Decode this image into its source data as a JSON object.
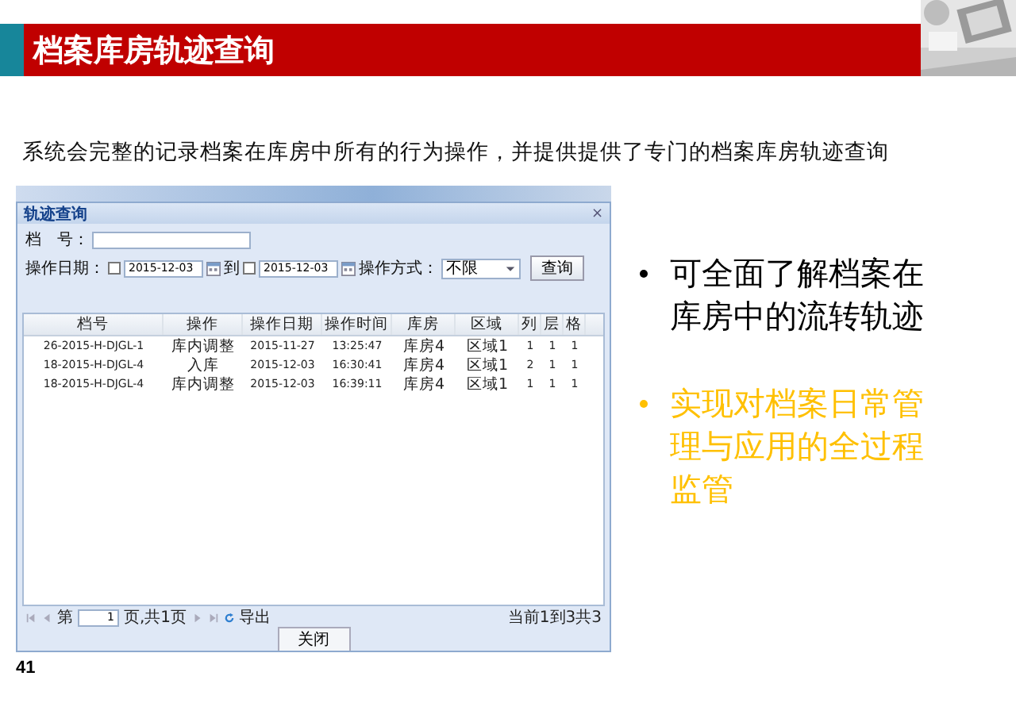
{
  "slide_title": "档案库房轨迹查询",
  "description": "系统会完整的记录档案在库房中所有的行为操作，并提供提供了专门的档案库房轨迹查询",
  "window": {
    "title": "轨迹查询",
    "close": "×",
    "filters": {
      "file_no_label": "档　号：",
      "date_label": "操作日期：",
      "date_from": {
        "checked": false,
        "value": "2015-12-03"
      },
      "to_label": "到",
      "date_to": {
        "checked": false,
        "value": "2015-12-03"
      },
      "mode_label": "操作方式：",
      "mode_value": "不限",
      "search_button": "查询"
    },
    "table": {
      "columns": [
        "档号",
        "操作",
        "操作日期",
        "操作时间",
        "库房",
        "区域",
        "列",
        "层",
        "格"
      ],
      "rows": [
        [
          "26-2015-H-DJGL-1",
          "库内调整",
          "2015-11-27",
          "13:25:47",
          "库房4",
          "区域1",
          "1",
          "1",
          "1"
        ],
        [
          "18-2015-H-DJGL-4",
          "入库",
          "2015-12-03",
          "16:30:41",
          "库房4",
          "区域1",
          "2",
          "1",
          "1"
        ],
        [
          "18-2015-H-DJGL-4",
          "库内调整",
          "2015-12-03",
          "16:39:11",
          "库房4",
          "区域1",
          "1",
          "1",
          "1"
        ]
      ]
    },
    "pager": {
      "page_prefix": "第",
      "page": "1",
      "page_suffix": "页,共1页",
      "export": "导出",
      "summary": "当前1到3共3"
    },
    "close_button": "关闭"
  },
  "bullets": [
    {
      "text": "可全面了解档案在库房中的流转轨迹",
      "color": "#000000"
    },
    {
      "text": "实现对档案日常管理与应用的全过程监管",
      "color": "#ffc000"
    }
  ],
  "page_number": "41"
}
